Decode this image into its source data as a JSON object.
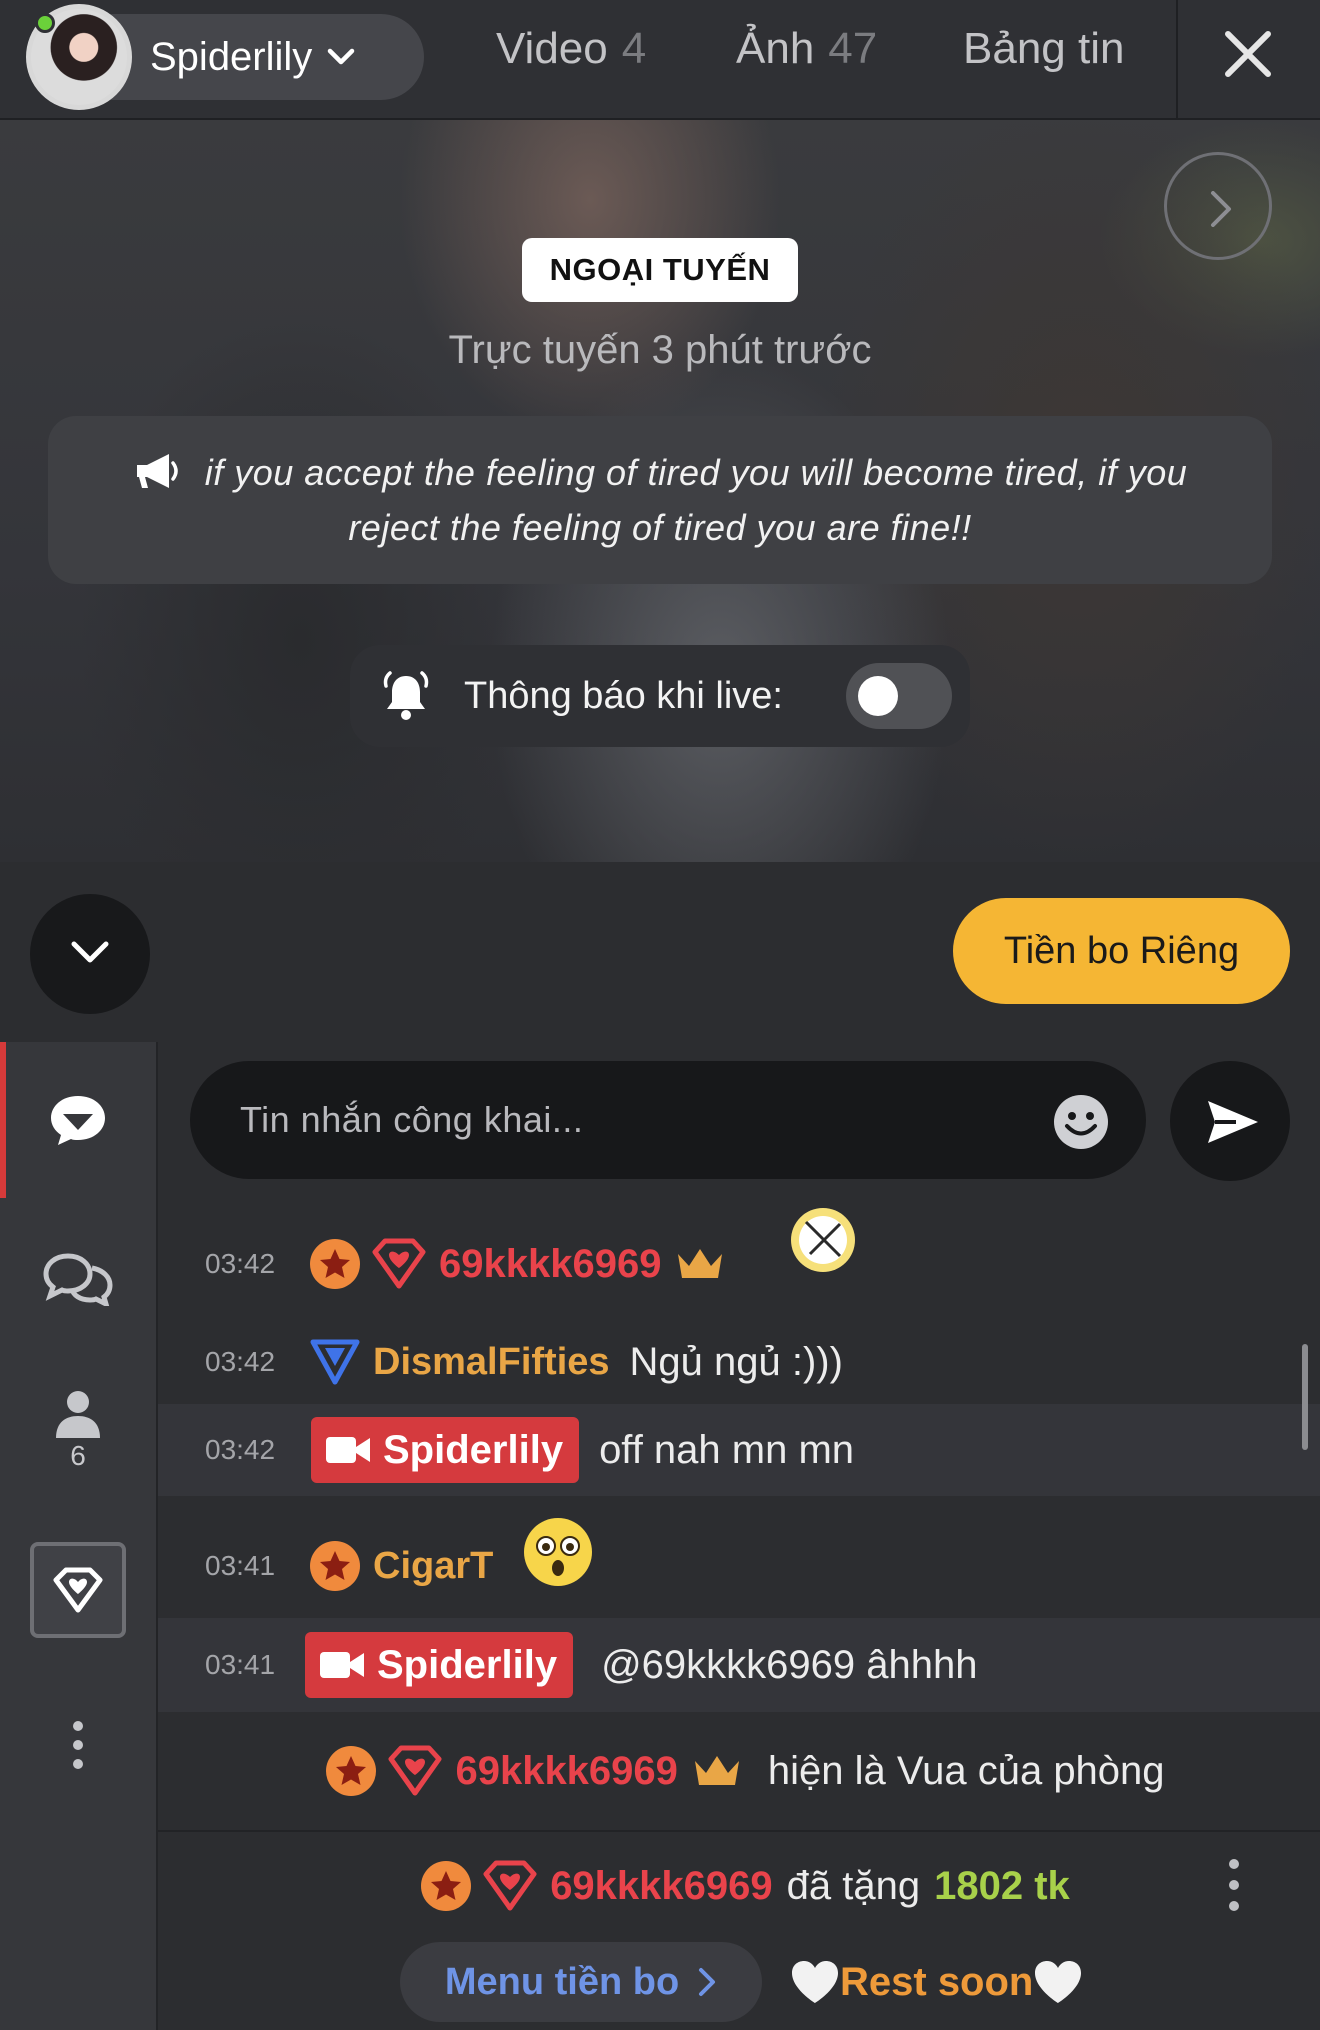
{
  "header": {
    "profile_name": "Spiderlily",
    "tabs": [
      {
        "label": "Video",
        "count": "4"
      },
      {
        "label": "Ảnh",
        "count": "47"
      },
      {
        "label": "Bảng tin",
        "count": ""
      }
    ]
  },
  "hero": {
    "status_badge": "NGOẠI TUYẾN",
    "last_online": "Trực tuyến 3 phút trước",
    "topic": "if you accept the feeling of tired you will become tired, if you reject the feeling of tired you are fine!!",
    "notify_label": "Thông báo khi live:",
    "notify_enabled": false
  },
  "actions": {
    "tip_button": "Tiền bo Riêng"
  },
  "sidebar": {
    "users_count": "6"
  },
  "chat": {
    "input_placeholder": "Tin nhắn công khai...",
    "messages": [
      {
        "time": "03:42",
        "user": "69kkkk6969",
        "text": ""
      },
      {
        "time": "03:42",
        "user": "DismalFifties",
        "text": "Ngủ ngủ :)))"
      },
      {
        "time": "03:42",
        "user": "Spiderlily",
        "text": "off nah mn mn"
      },
      {
        "time": "03:41",
        "user": "CigarT",
        "text": ""
      },
      {
        "time": "03:41",
        "user": "Spiderlily",
        "text": "@69kkkk6969  âhhhh"
      }
    ],
    "king_notice": {
      "user": "69kkkk6969",
      "text": "hiện là Vua của phòng"
    },
    "gift_notice": {
      "user": "69kkkk6969",
      "verb": "đã tặng",
      "amount": "1802 tk"
    },
    "menu_button": "Menu tiền bo",
    "rest_text": "Rest soon"
  },
  "colors": {
    "accent_yellow": "#f5b634",
    "host_red": "#d53a3e",
    "user_red": "#e9434b",
    "user_gold": "#e9a646",
    "amount_green": "#a8d14a",
    "link_blue": "#6f94e6"
  },
  "icons": [
    "chevron-down-icon",
    "close-icon",
    "chevron-right-icon",
    "megaphone-icon",
    "bell-icon",
    "emoji-icon",
    "send-icon",
    "chat-bubble-icon",
    "chats-icon",
    "user-icon",
    "diamond-gift-icon",
    "more-vertical-icon",
    "star-badge-icon",
    "diamond-badge-icon",
    "crown-icon",
    "camera-icon",
    "heart-icon"
  ]
}
